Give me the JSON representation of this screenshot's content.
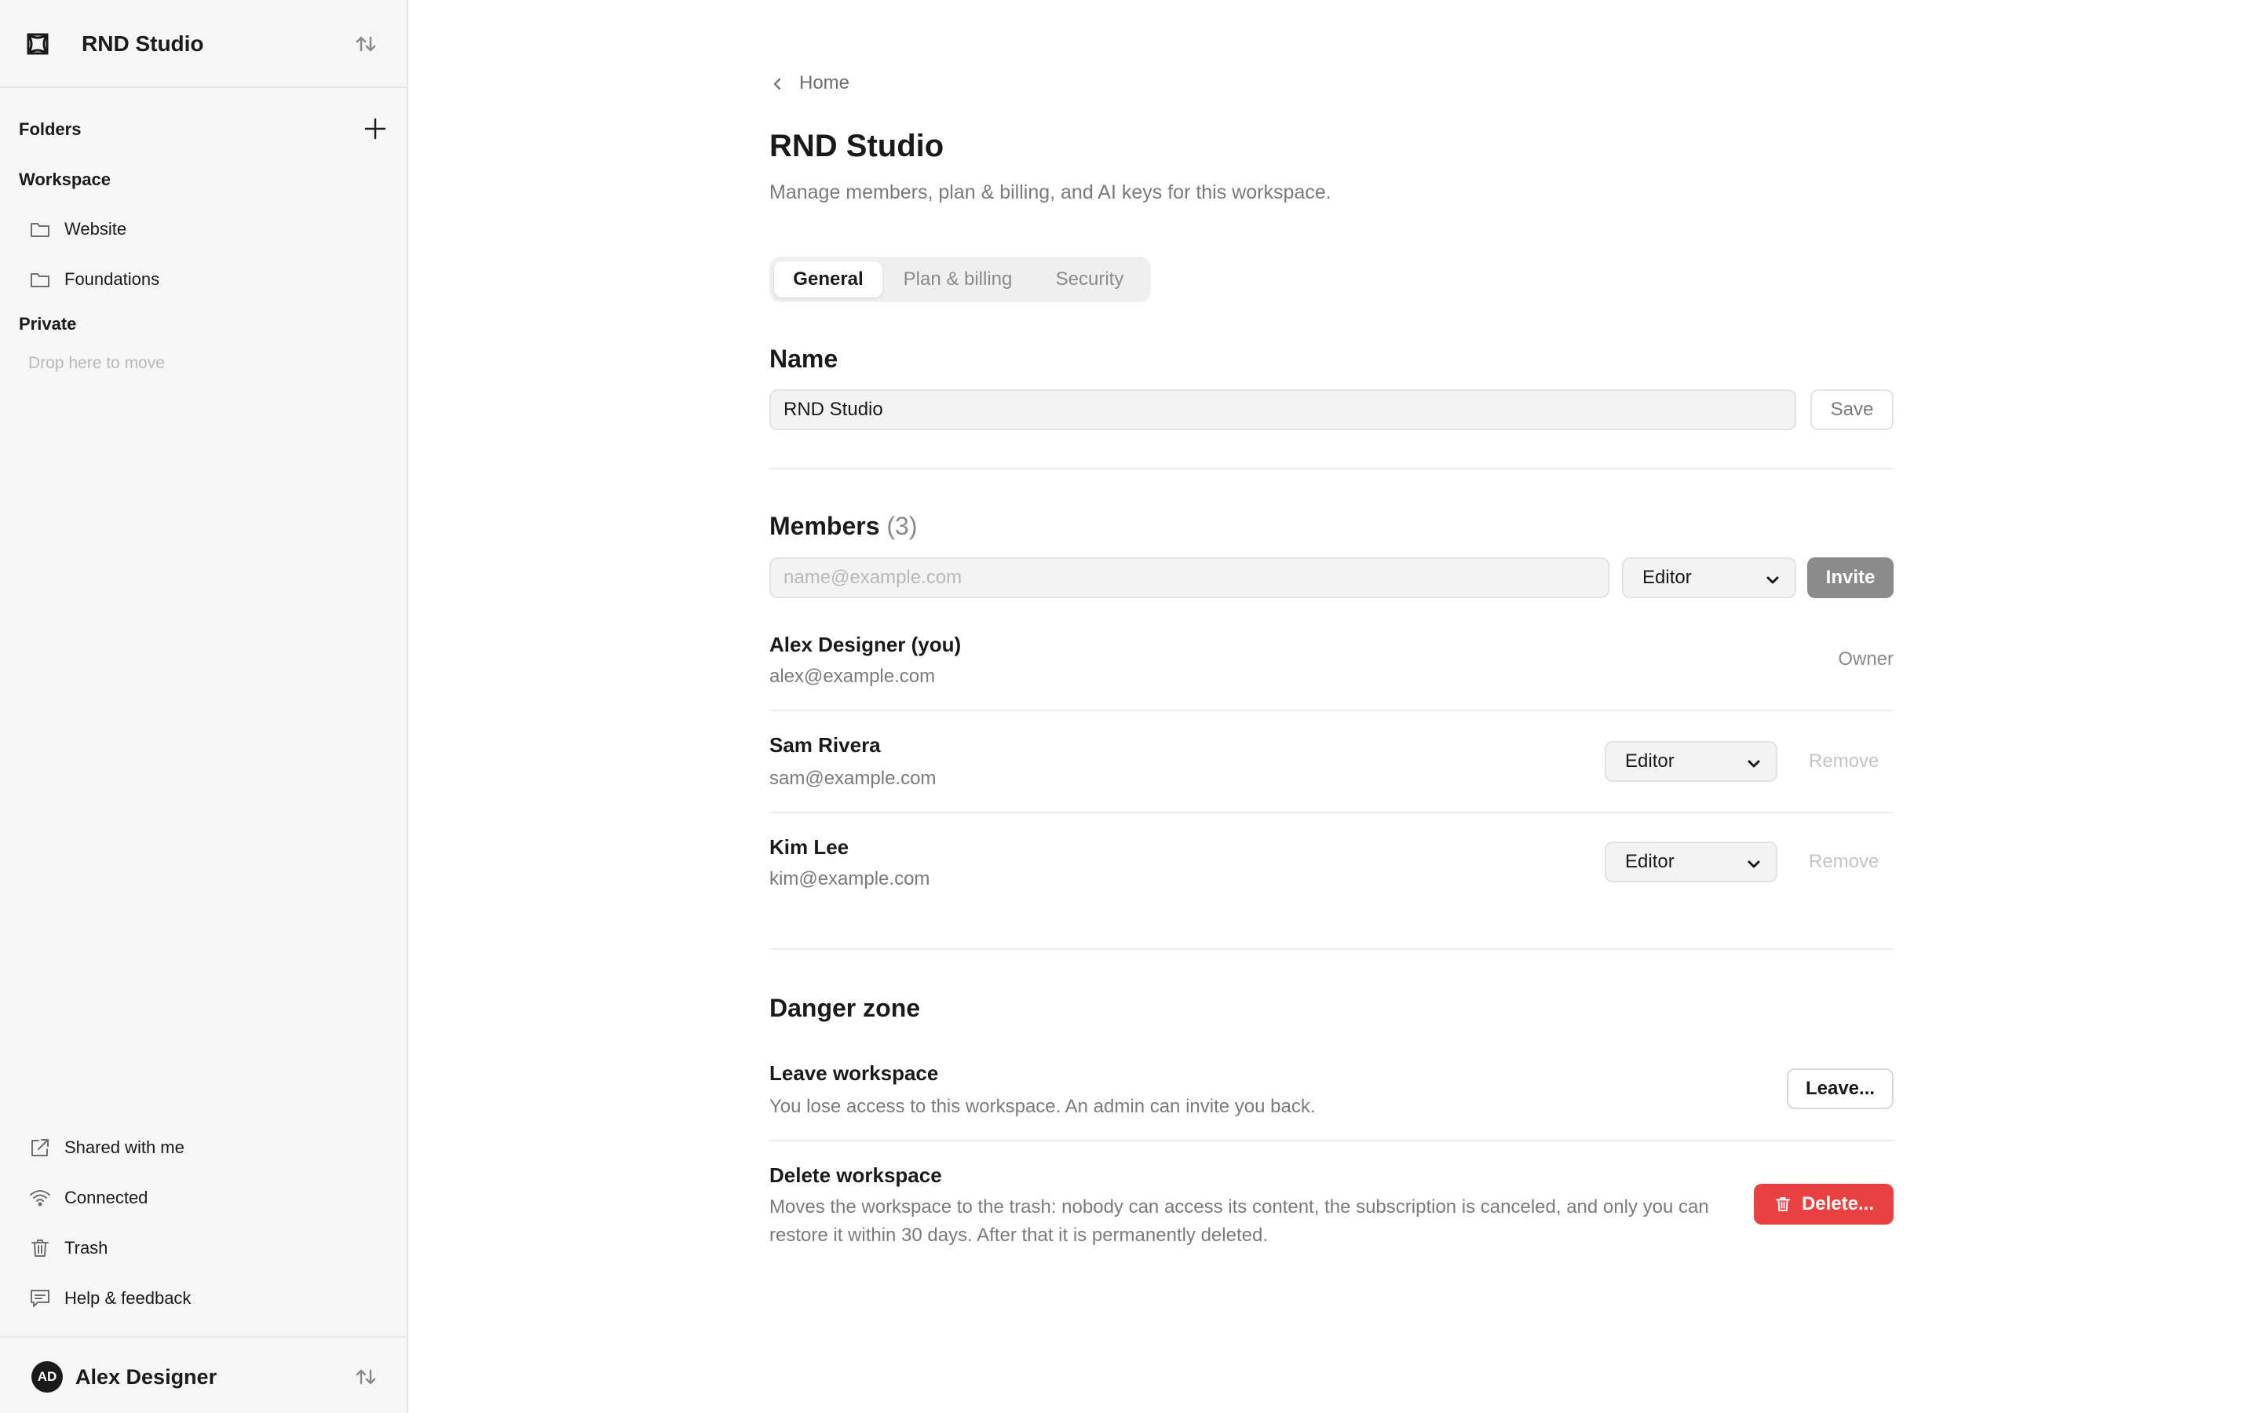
{
  "workspace": {
    "name": "RND Studio"
  },
  "sidebar": {
    "folders_label": "Folders",
    "workspace_label": "Workspace",
    "workspace_items": [
      {
        "label": "Website",
        "icon": "folder-icon"
      },
      {
        "label": "Foundations",
        "icon": "folder-icon"
      }
    ],
    "private_label": "Private",
    "drop_hint": "Drop here to move",
    "bottom_items": [
      {
        "label": "Shared with me",
        "icon": "external-link-icon"
      },
      {
        "label": "Connected",
        "icon": "wifi-icon"
      },
      {
        "label": "Trash",
        "icon": "trash-icon"
      },
      {
        "label": "Help & feedback",
        "icon": "chat-icon"
      }
    ],
    "user": {
      "initials": "AD",
      "name": "Alex Designer"
    }
  },
  "main": {
    "breadcrumb": "Home",
    "title": "RND Studio",
    "description": "Manage members, plan & billing, and AI keys for this workspace.",
    "tabs": [
      {
        "label": "General",
        "active": true
      },
      {
        "label": "Plan & billing",
        "active": false
      },
      {
        "label": "Security",
        "active": false
      }
    ],
    "name_section": {
      "title": "Name",
      "value": "RND Studio",
      "save_label": "Save"
    },
    "members_section": {
      "title": "Members",
      "count": "(3)",
      "invite_placeholder": "name@example.com",
      "invite_role": "Editor",
      "invite_label": "Invite",
      "members": [
        {
          "name": "Alex Designer (you)",
          "email": "alex@example.com",
          "role": "Owner"
        },
        {
          "name": "Sam Rivera",
          "email": "sam@example.com",
          "role": "Editor",
          "remove_label": "Remove"
        },
        {
          "name": "Kim Lee",
          "email": "kim@example.com",
          "role": "Editor",
          "remove_label": "Remove"
        }
      ]
    },
    "danger_zone": {
      "title": "Danger zone",
      "leave": {
        "title": "Leave workspace",
        "description": "You lose access to this workspace. An admin can invite you back.",
        "button_label": "Leave..."
      },
      "delete": {
        "title": "Delete workspace",
        "description": "Moves the workspace to the trash: nobody can access its content, the subscription is canceled, and only you can restore it within 30 days. After that it is permanently deleted.",
        "button_label": "Delete..."
      }
    }
  },
  "colors": {
    "danger": "#e94141",
    "sidebar_bg": "#f6f6f6",
    "invite_button": "#8b8b8b"
  }
}
